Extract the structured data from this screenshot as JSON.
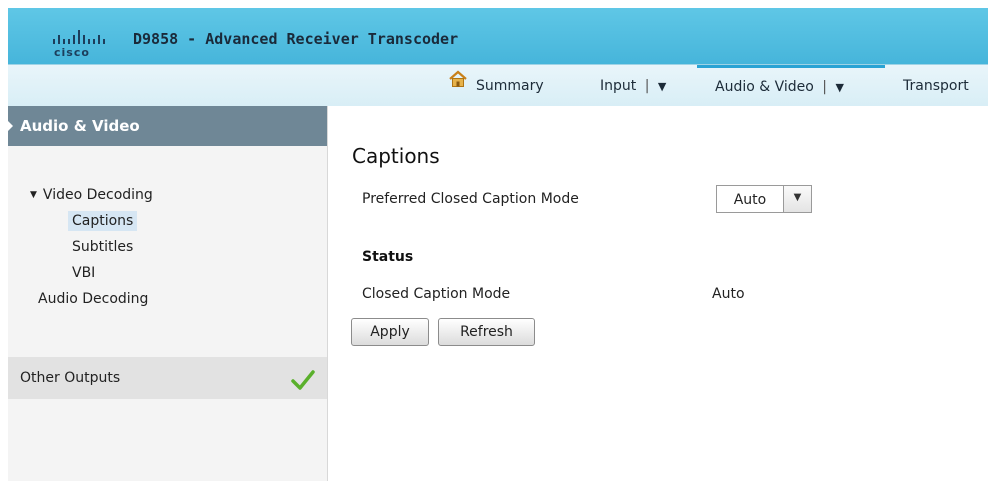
{
  "header": {
    "logo_text": "cisco",
    "title": "D9858 - Advanced Receiver Transcoder"
  },
  "nav": {
    "summary": "Summary",
    "input": "Input",
    "audio_video": "Audio & Video",
    "transport": "Transport",
    "dropdown_caret": "▼",
    "separator": "|"
  },
  "sidebar": {
    "header": "Audio & Video",
    "video_decoding": "Video Decoding",
    "captions": "Captions",
    "subtitles": "Subtitles",
    "vbi": "VBI",
    "audio_decoding": "Audio Decoding",
    "other_outputs": "Other Outputs"
  },
  "main": {
    "title": "Captions",
    "preferred_label": "Preferred Closed Caption Mode",
    "preferred_value": "Auto",
    "status_heading": "Status",
    "cc_mode_label": "Closed Caption Mode",
    "cc_mode_value": "Auto",
    "apply": "Apply",
    "refresh": "Refresh"
  },
  "colors": {
    "header_blue": "#45b4da",
    "sidebar_header": "#6f8796",
    "check_green": "#5ab02c"
  }
}
